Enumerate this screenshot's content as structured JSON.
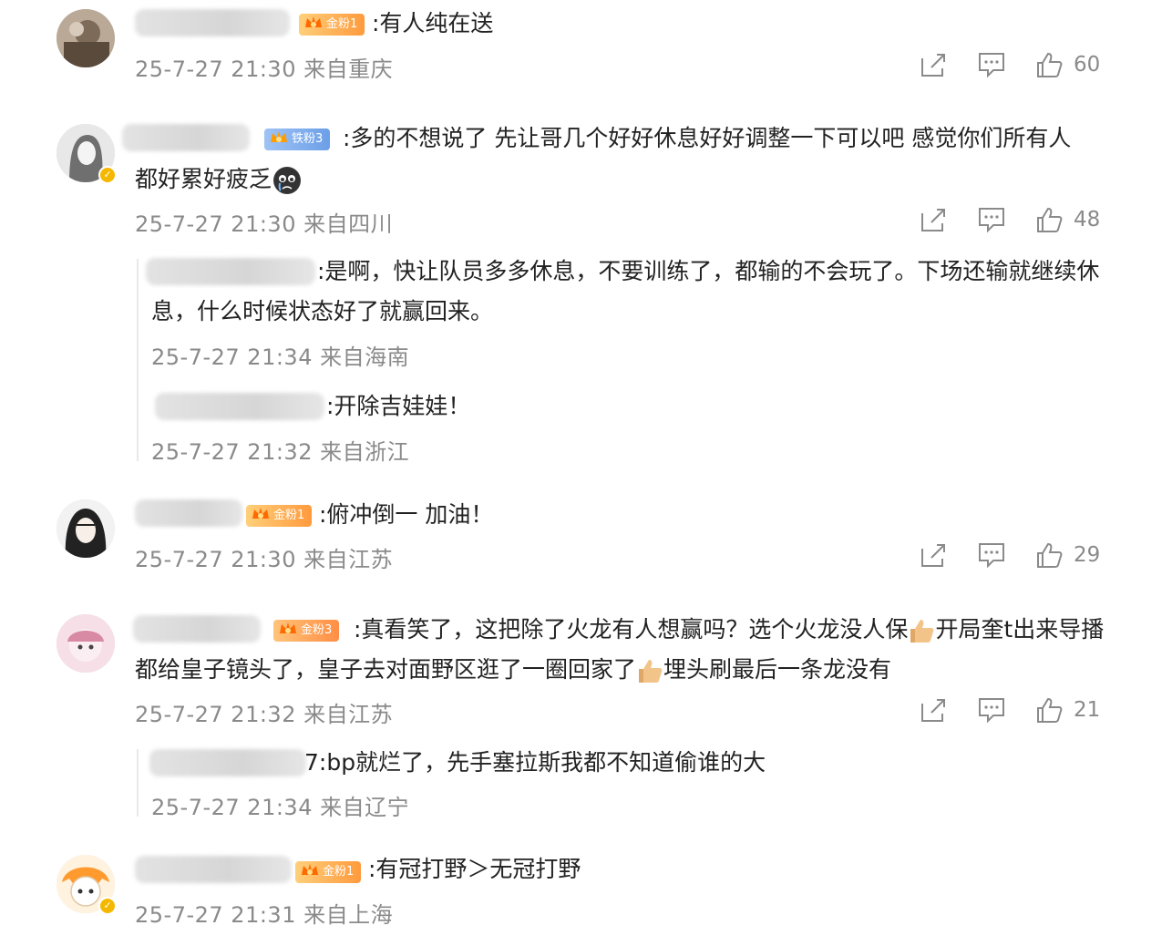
{
  "comments": [
    {
      "text": ":有人纯在送",
      "meta": "25-7-27 21:30 来自重庆",
      "badge": "金粉1",
      "share": "share-icon",
      "comment": "comment-icon",
      "likes": "60"
    },
    {
      "text1": ":多的不想说了  先让哥几个好好休息好好调整一下可以吧   感觉你们所有人",
      "text2": "都好累好疲乏",
      "meta": "25-7-27 21:30 来自四川",
      "badge": "铁粉3",
      "likes": "48",
      "replies": [
        {
          "text1": ":是啊，快让队员多多休息，不要训练了，都输的不会玩了。下场还输就继续休",
          "text2": "息，什么时候状态好了就赢回来。",
          "meta": "25-7-27 21:34 来自海南"
        },
        {
          "text": ":开除吉娃娃！",
          "meta": "25-7-27 21:32 来自浙江"
        }
      ]
    },
    {
      "text": ":俯冲倒一 加油！",
      "meta": "25-7-27 21:30 来自江苏",
      "badge": "金粉1",
      "likes": "29"
    },
    {
      "text1": ":真看笑了，这把除了火龙有人想赢吗？选个火龙没人保",
      "text1b": "开局奎t出来导播",
      "text2": "都给皇子镜头了，皇子去对面野区逛了一圈回家了",
      "text2b": "埋头刷最后一条龙没有",
      "meta": "25-7-27 21:32 来自江苏",
      "badge": "金粉3",
      "likes": "21",
      "replies": [
        {
          "text": "7:bp就烂了，先手塞拉斯我都不知道偷谁的大",
          "meta": "25-7-27 21:34 来自辽宁"
        }
      ]
    },
    {
      "text": ":有冠打野＞无冠打野",
      "meta": "25-7-27 21:31 来自上海",
      "badge": "金粉1"
    }
  ],
  "colors": {
    "meta": "#8a8a8a",
    "text": "#222222",
    "badge_gold": "#ff9a3d",
    "badge_blue": "#6c9fe8",
    "verified": "#f5b800"
  }
}
